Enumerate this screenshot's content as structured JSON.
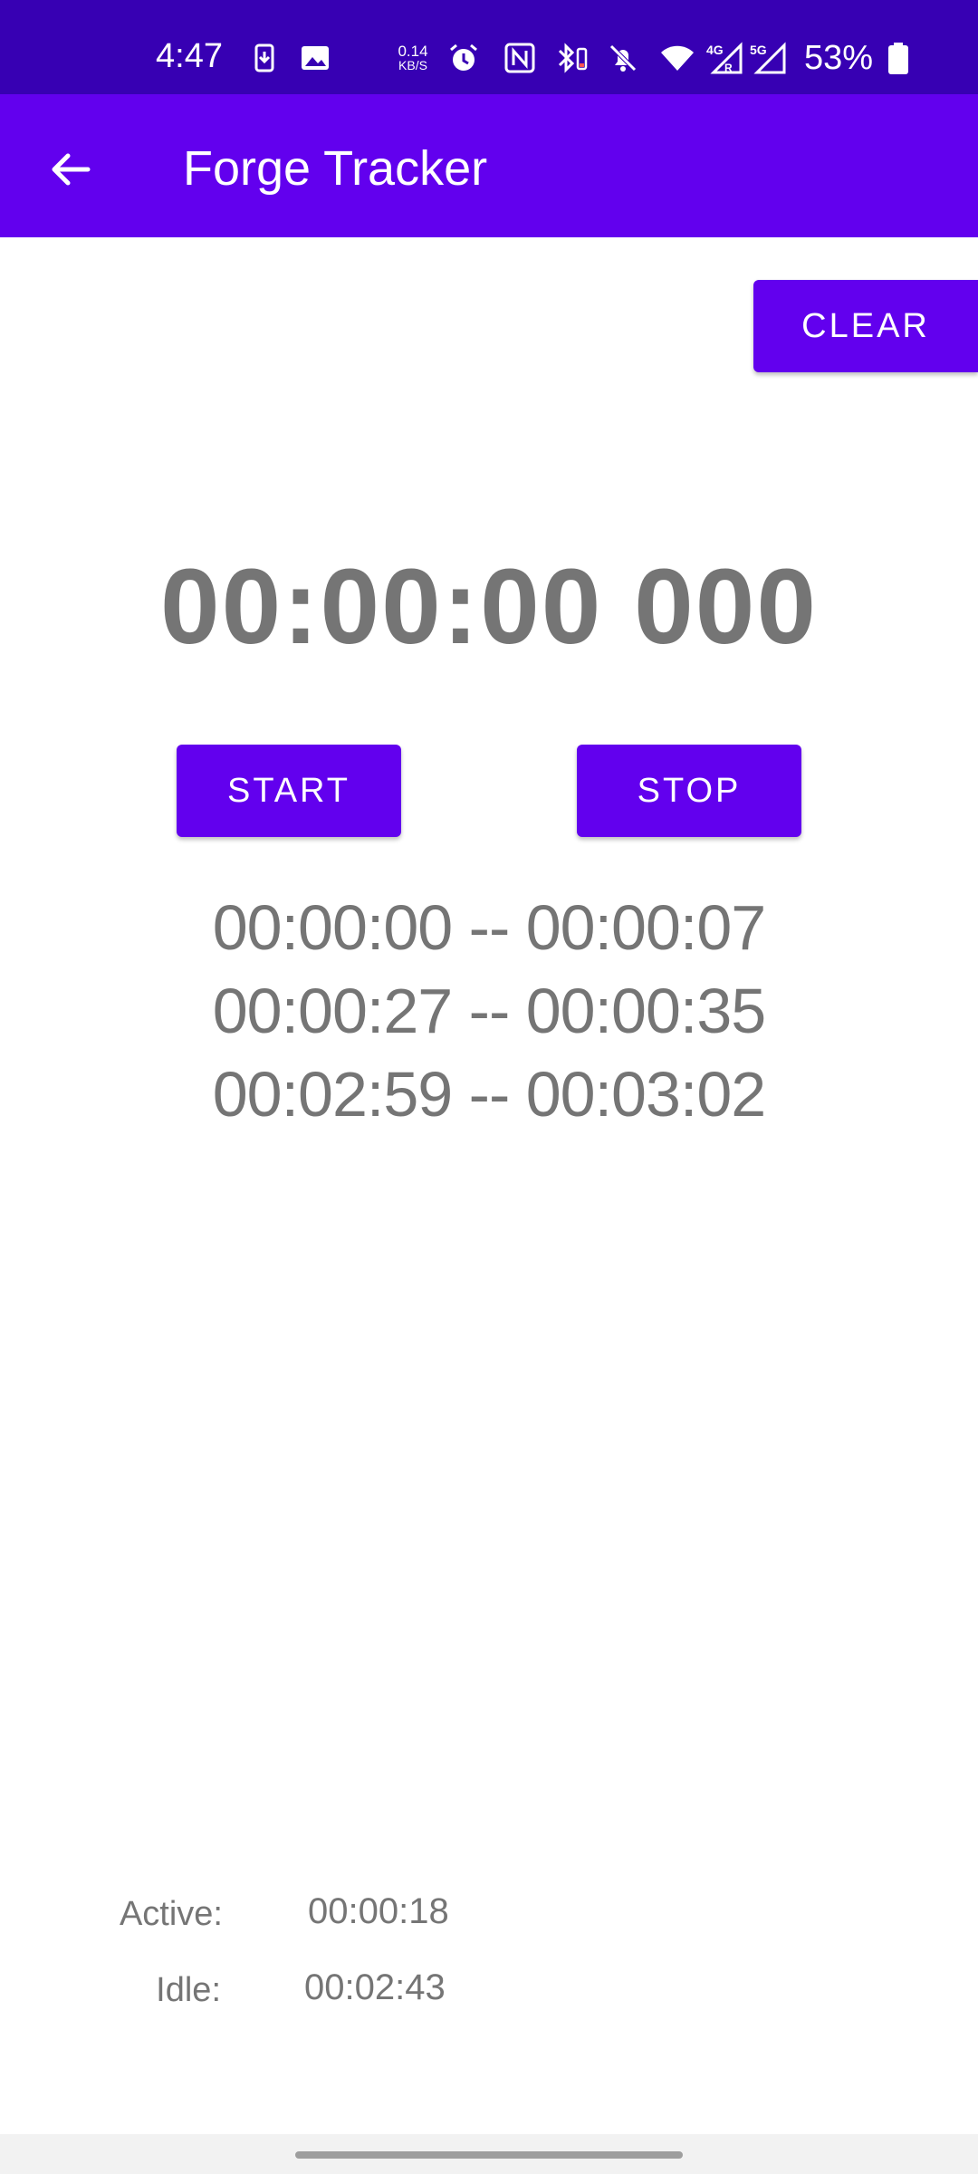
{
  "status_bar": {
    "time": "4:47",
    "net_speed_value": "0.14",
    "net_speed_unit": "KB/S",
    "battery_percent": "53%",
    "network_4g": "4G",
    "network_5g": "5G"
  },
  "app_bar": {
    "title": "Forge Tracker"
  },
  "actions": {
    "clear_label": "CLEAR",
    "start_label": "START",
    "stop_label": "STOP"
  },
  "timer": {
    "display": "00:00:00 000"
  },
  "sessions": [
    "00:00:00 -- 00:00:07",
    "00:00:27 -- 00:00:35",
    "00:02:59 -- 00:03:02"
  ],
  "summary": {
    "active_label": "Active:",
    "active_value": "00:00:18",
    "idle_label": "Idle:",
    "idle_value": "00:02:43"
  },
  "colors": {
    "status_bar": "#3700b3",
    "primary": "#6200ee",
    "text_gray": "#757575"
  }
}
